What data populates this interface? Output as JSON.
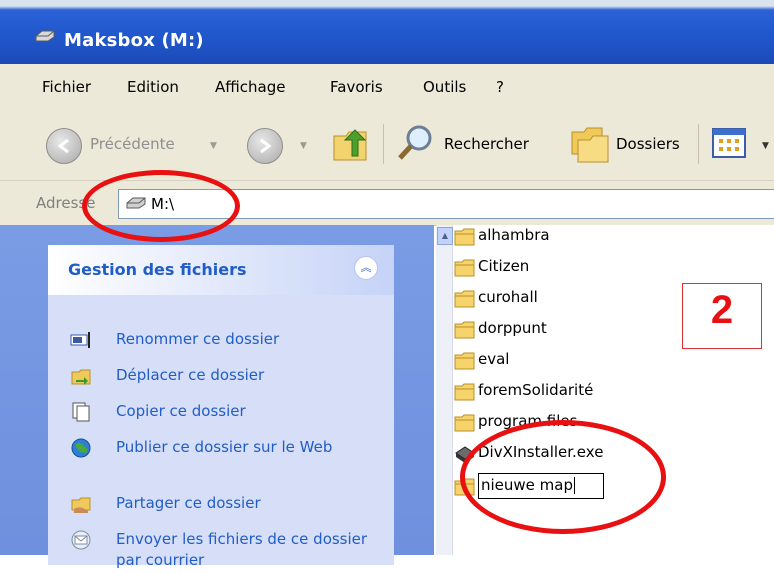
{
  "window": {
    "title": "Maksbox (M:)",
    "icon": "drive-icon"
  },
  "menu": [
    "Fichier",
    "Edition",
    "Affichage",
    "Favoris",
    "Outils",
    "?"
  ],
  "toolbar": {
    "back_label": "Précédente",
    "search_label": "Rechercher",
    "folders_label": "Dossiers"
  },
  "address": {
    "label": "Adresse",
    "value": "M:\\"
  },
  "tasks": {
    "title": "Gestion des fichiers",
    "items": [
      {
        "label": "Renommer ce dossier",
        "icon": "rename-icon"
      },
      {
        "label": "Déplacer ce dossier",
        "icon": "move-icon"
      },
      {
        "label": "Copier ce dossier",
        "icon": "copy-icon"
      },
      {
        "label": "Publier ce dossier sur le Web",
        "icon": "publish-web-icon"
      },
      {
        "label": "Partager ce dossier",
        "icon": "share-icon"
      },
      {
        "label": "Envoyer les fichiers de ce dossier par courrier",
        "icon": "mail-icon"
      }
    ]
  },
  "files": [
    {
      "name": "alhambra",
      "type": "folder"
    },
    {
      "name": "Citizen",
      "type": "folder"
    },
    {
      "name": "curohall",
      "type": "folder"
    },
    {
      "name": "dorppunt",
      "type": "folder"
    },
    {
      "name": "eval",
      "type": "folder"
    },
    {
      "name": "foremSolidarité",
      "type": "folder"
    },
    {
      "name": "program files",
      "type": "folder"
    },
    {
      "name": "DivXInstaller.exe",
      "type": "exe"
    }
  ],
  "rename_field": {
    "value": "nieuwe map"
  },
  "annotation": {
    "step_number": "2",
    "color": "#e81010"
  },
  "colors": {
    "titlebar": "#2359cf",
    "chrome": "#ece9d8",
    "task_link": "#215dc6",
    "side_panel": "#7a9ce5"
  }
}
